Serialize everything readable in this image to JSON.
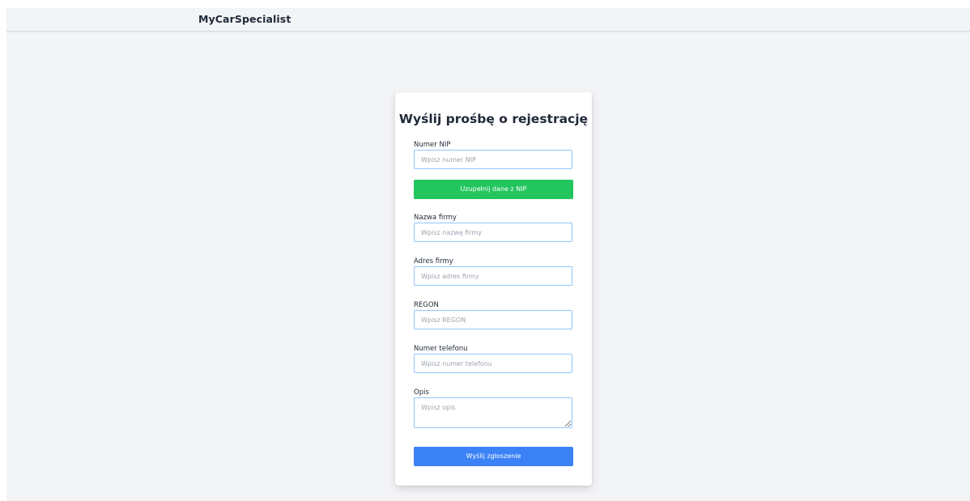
{
  "navbar": {
    "brand": "MyCarSpecialist"
  },
  "form": {
    "title": "Wyślij prośbę o rejestrację",
    "nip": {
      "label": "Numer NIP",
      "placeholder": "Wpisz numer NIP",
      "value": ""
    },
    "fill_from_nip_button": "Uzupełnij dane z NIP",
    "company_name": {
      "label": "Nazwa firmy",
      "placeholder": "Wpisz nazwę firmy",
      "value": ""
    },
    "company_address": {
      "label": "Adres firmy",
      "placeholder": "Wpisz adres firmy",
      "value": ""
    },
    "regon": {
      "label": "REGON",
      "placeholder": "Wpisz REGON",
      "value": ""
    },
    "phone": {
      "label": "Numer telefonu",
      "placeholder": "Wpisz numer telefonu",
      "value": ""
    },
    "description": {
      "label": "Opis",
      "placeholder": "Wpisz opis",
      "value": ""
    },
    "submit_button": "Wyślij zgłoszenie"
  },
  "colors": {
    "background": "#f3f4f6",
    "card": "#ffffff",
    "input_border": "#93c5fd",
    "primary_blue": "#3b82f6",
    "success_green": "#22c55e",
    "text_dark": "#1f2937"
  }
}
